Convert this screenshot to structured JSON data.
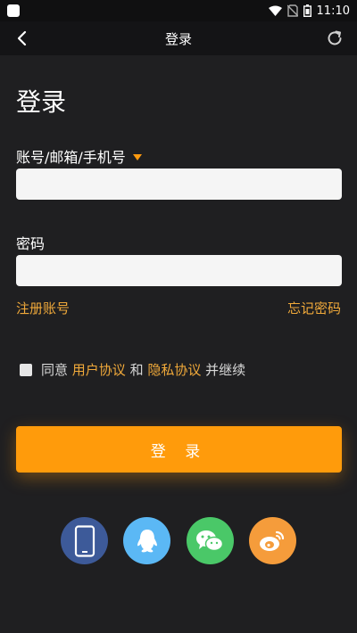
{
  "status_bar": {
    "time": "11:10"
  },
  "nav": {
    "title": "登录"
  },
  "page": {
    "heading": "登录"
  },
  "form": {
    "account_label": "账号/邮箱/手机号",
    "account_value": "",
    "password_label": "密码",
    "password_value": "",
    "register_link": "注册账号",
    "forgot_link": "忘记密码"
  },
  "agreement": {
    "prefix": "同意 ",
    "user_agreement": "用户协议",
    "and": " 和 ",
    "privacy_policy": "隐私协议",
    "suffix": " 并继续"
  },
  "login_button": "登 录",
  "social_logins": [
    {
      "icon": "phone-icon",
      "color": "#3d5a99"
    },
    {
      "icon": "qq-icon",
      "color": "#5bb8f5"
    },
    {
      "icon": "wechat-icon",
      "color": "#4ac868"
    },
    {
      "icon": "weibo-icon",
      "color": "#f59c3b"
    }
  ],
  "colors": {
    "background": "#1f1f21",
    "accent": "#ff9b0b",
    "link": "#f0a93a"
  }
}
